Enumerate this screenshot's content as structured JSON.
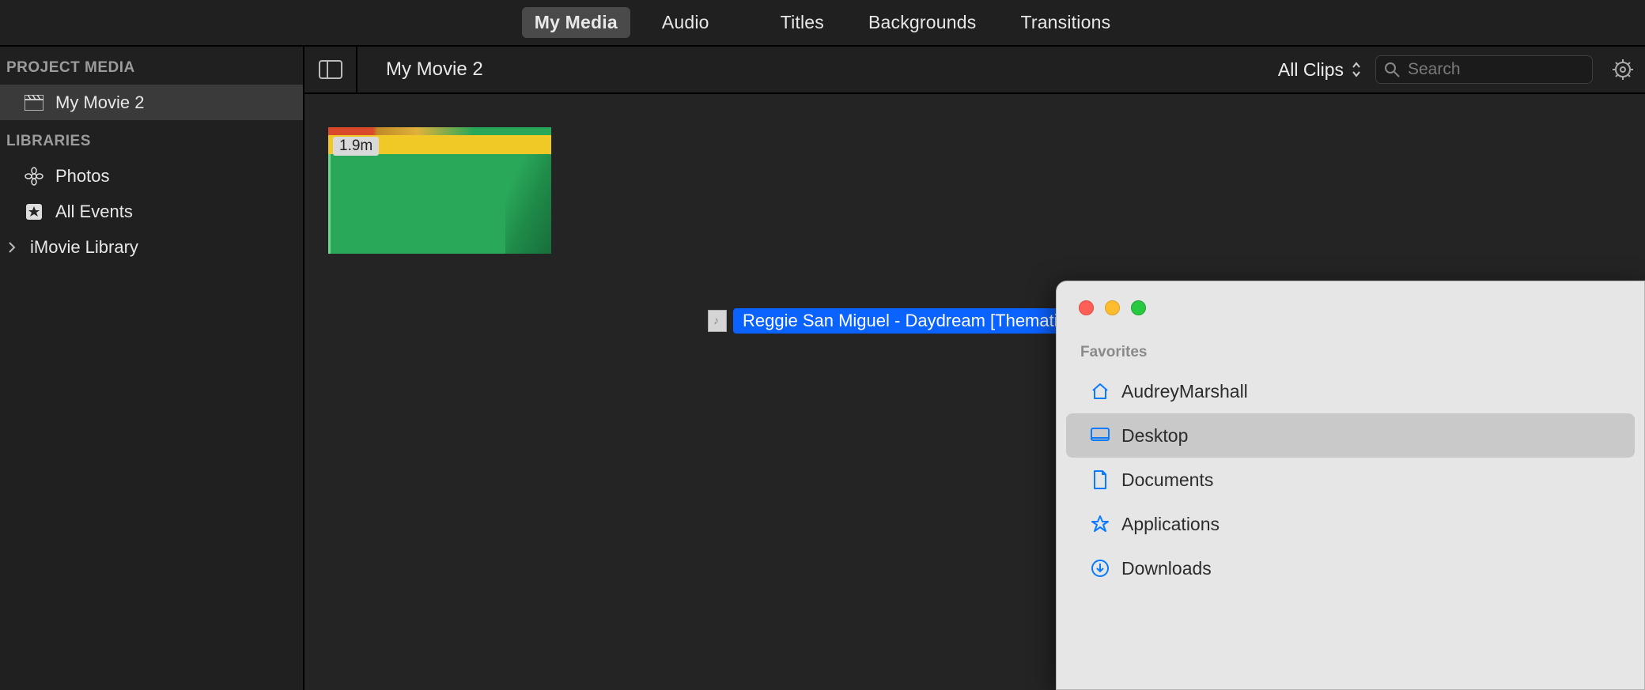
{
  "tabs": {
    "my_media": "My Media",
    "audio": "Audio",
    "titles": "Titles",
    "backgrounds": "Backgrounds",
    "transitions": "Transitions"
  },
  "sidebar": {
    "project_media_header": "PROJECT MEDIA",
    "project_name": "My Movie 2",
    "libraries_header": "LIBRARIES",
    "photos": "Photos",
    "all_events": "All Events",
    "imovie_library": "iMovie Library"
  },
  "content": {
    "title": "My Movie 2",
    "filter_label": "All Clips",
    "search_placeholder": "Search"
  },
  "clip": {
    "duration": "1.9m"
  },
  "drag": {
    "filename": "Reggie San Miguel - Daydream [Thematic].wav"
  },
  "finder": {
    "favorites_header": "Favorites",
    "items": {
      "home": "AudreyMarshall",
      "desktop": "Desktop",
      "documents": "Documents",
      "applications": "Applications",
      "downloads": "Downloads"
    }
  }
}
